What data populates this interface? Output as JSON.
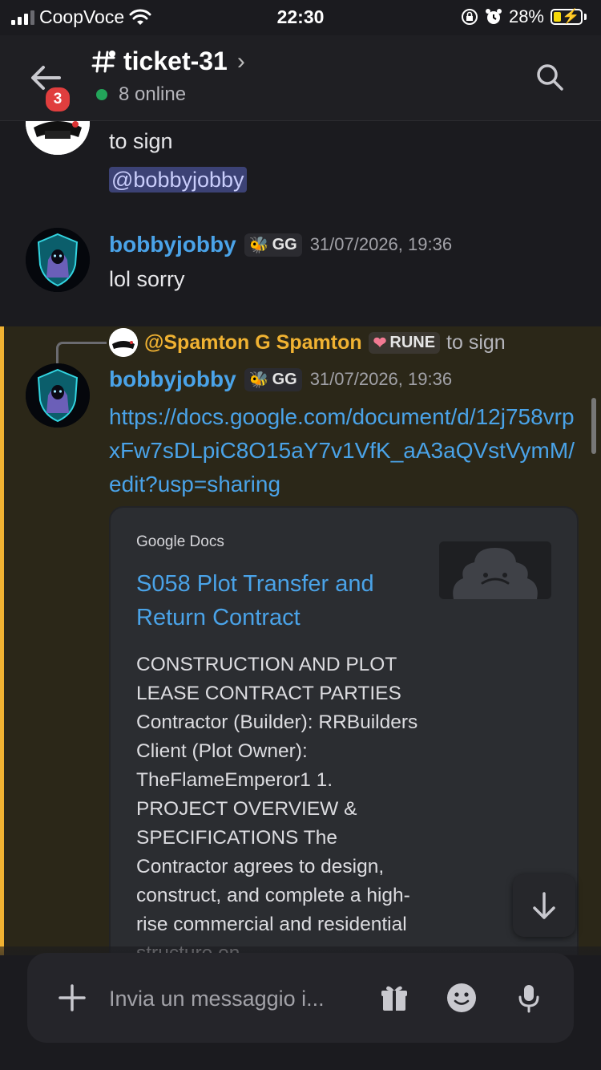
{
  "status_bar": {
    "carrier": "CoopVoce",
    "time": "22:30",
    "battery": "28%",
    "battery_level": 0.28
  },
  "header": {
    "channel": "ticket-31",
    "unread_badge": "3",
    "online": "8 online"
  },
  "messages": [
    {
      "text": "to sign",
      "mention": "@bobbyjobby"
    },
    {
      "author": "bobbyjobby",
      "tag": "GG",
      "timestamp": "31/07/2026, 19:36",
      "text": "lol sorry"
    }
  ],
  "reply": {
    "reply_to": "@Spamton G Spamton",
    "reply_tag": "RUNE",
    "reply_text": "to sign",
    "author": "bobbyjobby",
    "tag": "GG",
    "timestamp": "31/07/2026, 19:36",
    "link": "https://docs.google.com/document/d/12j758vrpxFw7sDLpiC8O15aY7v1VfK_aA3aQVstVymM/edit?usp=sharing"
  },
  "embed": {
    "provider": "Google Docs",
    "title": "S058 Plot Transfer and Return Contract",
    "description": "CONSTRUCTION AND PLOT LEASE CONTRACT PARTIES Contractor (Builder): RRBuilders  Client (Plot Owner): TheFlameEmperor1 1. PROJECT OVERVIEW & SPECIFICATIONS The Contractor agrees to design, construct, and complete a high-rise commercial and residential structure on"
  },
  "composer": {
    "placeholder": "Invia un messaggio i..."
  },
  "colors": {
    "accent_link": "#4aa3e8",
    "reply_name": "#f0b232",
    "online_dot": "#23a55a",
    "badge": "#e03e3e",
    "highlight_bar": "#f0b232"
  },
  "icons": [
    "signal-icon",
    "wifi-icon",
    "lock-rotation-icon",
    "alarm-icon",
    "battery-icon",
    "back-arrow-icon",
    "hash-icon",
    "chevron-right-icon",
    "search-icon",
    "plus-icon",
    "gift-icon",
    "emoji-icon",
    "mic-icon",
    "arrow-down-icon"
  ]
}
